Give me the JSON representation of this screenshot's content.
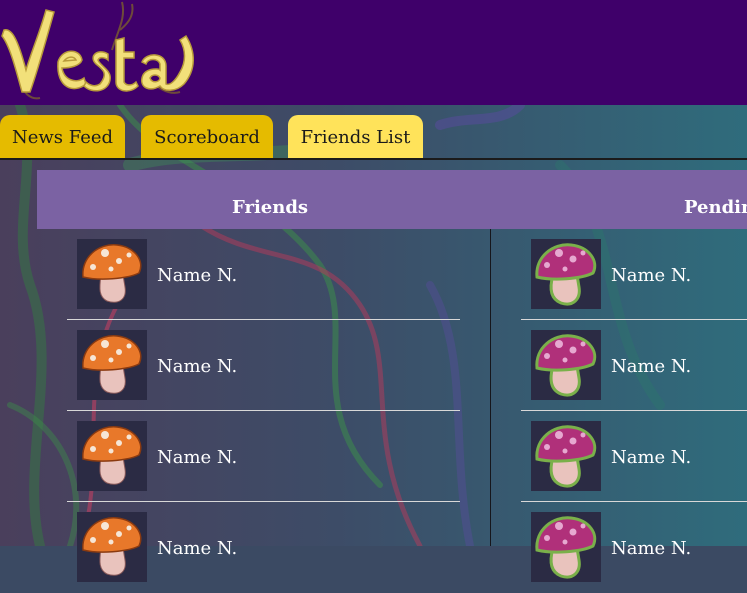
{
  "app": {
    "logo_text": "Vesta"
  },
  "tabs": [
    {
      "label": "News Feed",
      "active": false
    },
    {
      "label": "Scoreboard",
      "active": false
    },
    {
      "label": "Friends List",
      "active": true
    }
  ],
  "friends": {
    "title": "Friends",
    "items": [
      {
        "name": "Name N.",
        "avatar": "orange-mushroom-icon"
      },
      {
        "name": "Name N.",
        "avatar": "orange-mushroom-icon"
      },
      {
        "name": "Name N.",
        "avatar": "orange-mushroom-icon"
      },
      {
        "name": "Name N.",
        "avatar": "orange-mushroom-icon"
      }
    ]
  },
  "pending": {
    "title": "Pending",
    "items": [
      {
        "name": "Name N.",
        "avatar": "pink-mushroom-icon"
      },
      {
        "name": "Name N.",
        "avatar": "pink-mushroom-icon"
      },
      {
        "name": "Name N.",
        "avatar": "pink-mushroom-icon"
      },
      {
        "name": "Name N.",
        "avatar": "pink-mushroom-icon"
      }
    ]
  },
  "colors": {
    "header": "#3f006a",
    "tab_inactive": "#e5bb00",
    "tab_active": "#ffe35a",
    "panel_header": "#7b62a3",
    "orange_cap": "#e8782a",
    "pink_cap": "#b0307a"
  }
}
